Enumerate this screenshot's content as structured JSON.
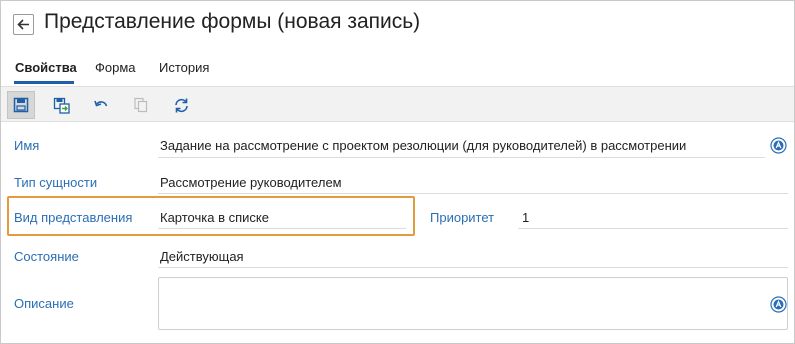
{
  "header": {
    "title": "Представление формы (новая запись)"
  },
  "tabs": [
    {
      "label": "Свойства",
      "active": true
    },
    {
      "label": "Форма",
      "active": false
    },
    {
      "label": "История",
      "active": false
    }
  ],
  "toolbar": {
    "buttons": [
      "save-icon",
      "save-as-icon",
      "undo-icon",
      "copy-icon",
      "refresh-icon"
    ]
  },
  "fields": {
    "name": {
      "label": "Имя",
      "value": "Задание на рассмотрение с проектом резолюции (для руководителей) в рассмотрении"
    },
    "entity_type": {
      "label": "Тип сущности",
      "value": "Рассмотрение руководителем"
    },
    "view_type": {
      "label": "Вид представления",
      "value": "Карточка в списке"
    },
    "priority": {
      "label": "Приоритет",
      "value": "1"
    },
    "state": {
      "label": "Состояние",
      "value": "Действующая"
    },
    "description": {
      "label": "Описание",
      "value": ""
    }
  },
  "colors": {
    "accent": "#1f5fa8",
    "label": "#2a6fb5",
    "highlight": "#e49a3e",
    "toolbar_bg": "#f2f2f2"
  }
}
